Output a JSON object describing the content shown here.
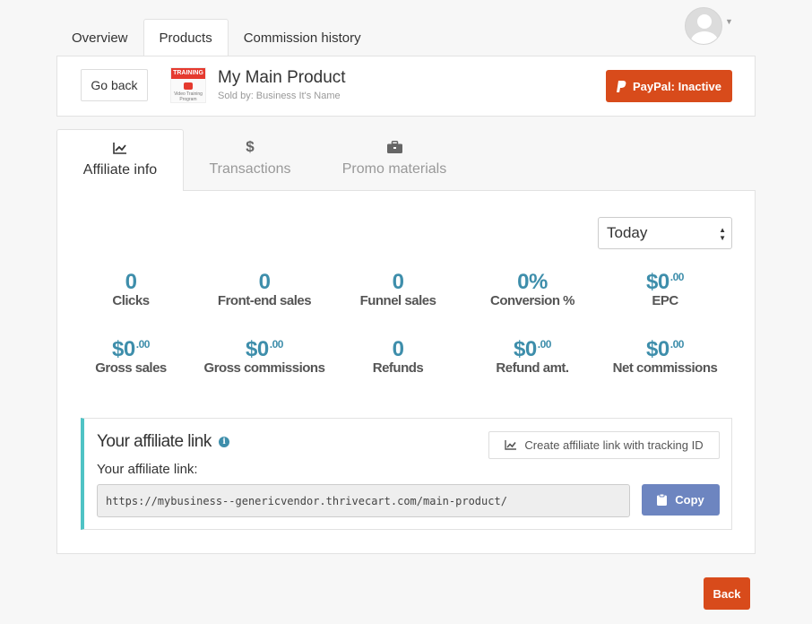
{
  "top_tabs": [
    {
      "label": "Overview"
    },
    {
      "label": "Products"
    },
    {
      "label": "Commission history"
    }
  ],
  "product": {
    "go_back_label": "Go back",
    "name": "My Main Product",
    "seller": "Sold by: Business It's Name",
    "thumb_top": "TRAINING",
    "thumb_caption": "Video Training Program",
    "paypal_label": "PayPal: Inactive",
    "paypal_icon": "paypal-icon"
  },
  "inner_tabs": [
    {
      "label": "Affiliate info",
      "icon": "chart-line-icon"
    },
    {
      "label": "Transactions",
      "icon": "dollar-icon"
    },
    {
      "label": "Promo materials",
      "icon": "briefcase-icon"
    }
  ],
  "period": {
    "selected": "Today"
  },
  "stats": {
    "clicks": {
      "value": "0",
      "label": "Clicks"
    },
    "frontend_sales": {
      "value": "0",
      "label": "Front-end sales"
    },
    "funnel_sales": {
      "value": "0",
      "label": "Funnel sales"
    },
    "conversion": {
      "value": "0%",
      "label": "Conversion %"
    },
    "epc": {
      "value": "$0",
      "cents": ".00",
      "label": "EPC"
    },
    "gross_sales": {
      "value": "$0",
      "cents": ".00",
      "label": "Gross sales"
    },
    "gross_commissions": {
      "value": "$0",
      "cents": ".00",
      "label": "Gross commissions"
    },
    "refunds": {
      "value": "0",
      "label": "Refunds"
    },
    "refund_amt": {
      "value": "$0",
      "cents": ".00",
      "label": "Refund amt."
    },
    "net_commissions": {
      "value": "$0",
      "cents": ".00",
      "label": "Net commissions"
    }
  },
  "affiliate": {
    "title": "Your affiliate link",
    "info_icon": "i",
    "tracking_button_label": "Create affiliate link with tracking ID",
    "link_label": "Your affiliate link:",
    "link_value": "https://mybusiness--genericvendor.thrivecart.com/main-product/",
    "copy_label": "Copy"
  },
  "footer": {
    "back_label": "Back"
  },
  "colors": {
    "accent": "#3e8eab",
    "danger": "#d84b1b",
    "copy": "#6d85c0",
    "link_border": "#4fc3c5"
  }
}
